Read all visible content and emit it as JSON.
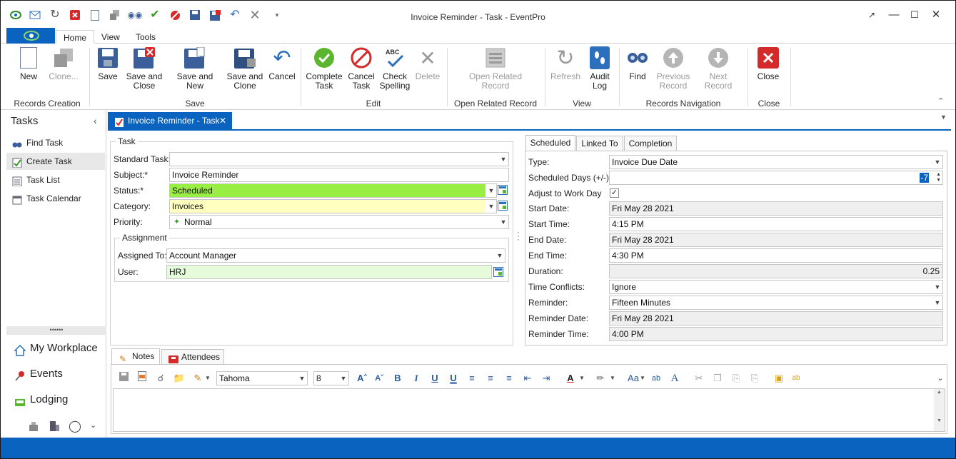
{
  "window": {
    "title": "Invoice Reminder - Task - EventPro"
  },
  "qat_icons": [
    "eventpro-logo-icon",
    "email-icon",
    "refresh-icon",
    "delete-icon",
    "new-document-icon",
    "clone-icon",
    "find-icon",
    "check-icon",
    "cancel-icon",
    "save-icon",
    "save-close-icon",
    "undo-icon",
    "close-icon",
    "qat-dropdown-icon"
  ],
  "ribbon": {
    "tabs": [
      "Home",
      "View",
      "Tools"
    ],
    "buttons": {
      "new": "New",
      "clone": "Clone...",
      "save": "Save",
      "save_close": "Save and Close",
      "save_new": "Save and New",
      "save_clone": "Save and Clone",
      "cancel": "Cancel",
      "complete_task": "Complete Task",
      "cancel_task": "Cancel Task",
      "check_spelling": "Check Spelling",
      "delete": "Delete",
      "open_related": "Open Related Record",
      "refresh": "Refresh",
      "audit_log": "Audit Log",
      "find": "Find",
      "previous": "Previous Record",
      "next": "Next Record",
      "close": "Close"
    },
    "groups": {
      "records_creation": "Records Creation",
      "save": "Save",
      "edit": "Edit",
      "open_related": "Open Related Record",
      "view": "View",
      "records_navigation": "Records Navigation",
      "close": "Close"
    }
  },
  "sidebar": {
    "title": "Tasks",
    "items": [
      "Find Task",
      "Create Task",
      "Task List",
      "Task Calendar"
    ],
    "modules": [
      "My Workplace",
      "Events",
      "Lodging"
    ]
  },
  "doc_tab": {
    "label": "Invoice Reminder - Task"
  },
  "task": {
    "group_title": "Task",
    "standard_task": {
      "label": "Standard Task:",
      "value": ""
    },
    "subject": {
      "label": "Subject:*",
      "value": "Invoice Reminder"
    },
    "status": {
      "label": "Status:*",
      "value": "Scheduled"
    },
    "category": {
      "label": "Category:",
      "value": "Invoices"
    },
    "priority": {
      "label": "Priority:",
      "value": "Normal"
    },
    "assignment_title": "Assignment",
    "assigned_to": {
      "label": "Assigned To:",
      "value": "Account Manager"
    },
    "user": {
      "label": "User:",
      "value": "HRJ"
    }
  },
  "schedule_tabs": [
    "Scheduled",
    "Linked To",
    "Completion"
  ],
  "scheduled": {
    "type": {
      "label": "Type:",
      "value": "Invoice Due Date"
    },
    "days": {
      "label": "Scheduled Days (+/-):",
      "value": "-7"
    },
    "adjust": {
      "label": "Adjust to Work Day",
      "checked": true
    },
    "start_date": {
      "label": "Start Date:",
      "value": "Fri May 28 2021"
    },
    "start_time": {
      "label": "Start Time:",
      "value": "4:15 PM"
    },
    "end_date": {
      "label": "End Date:",
      "value": "Fri May 28 2021"
    },
    "end_time": {
      "label": "End Time:",
      "value": "4:30 PM"
    },
    "duration": {
      "label": "Duration:",
      "value": "0.25"
    },
    "conflicts": {
      "label": "Time Conflicts:",
      "value": "Ignore"
    },
    "reminder": {
      "label": "Reminder:",
      "value": "Fifteen Minutes"
    },
    "reminder_date": {
      "label": "Reminder Date:",
      "value": "Fri May 28 2021"
    },
    "reminder_time": {
      "label": "Reminder Time:",
      "value": "4:00 PM"
    }
  },
  "bottom_tabs": [
    "Notes",
    "Attendees"
  ],
  "editor": {
    "font": "Tahoma",
    "size": "8"
  },
  "colors": {
    "accent": "#0a63bf",
    "status_green": "#99ee44",
    "category_yellow": "#ffffc0"
  }
}
